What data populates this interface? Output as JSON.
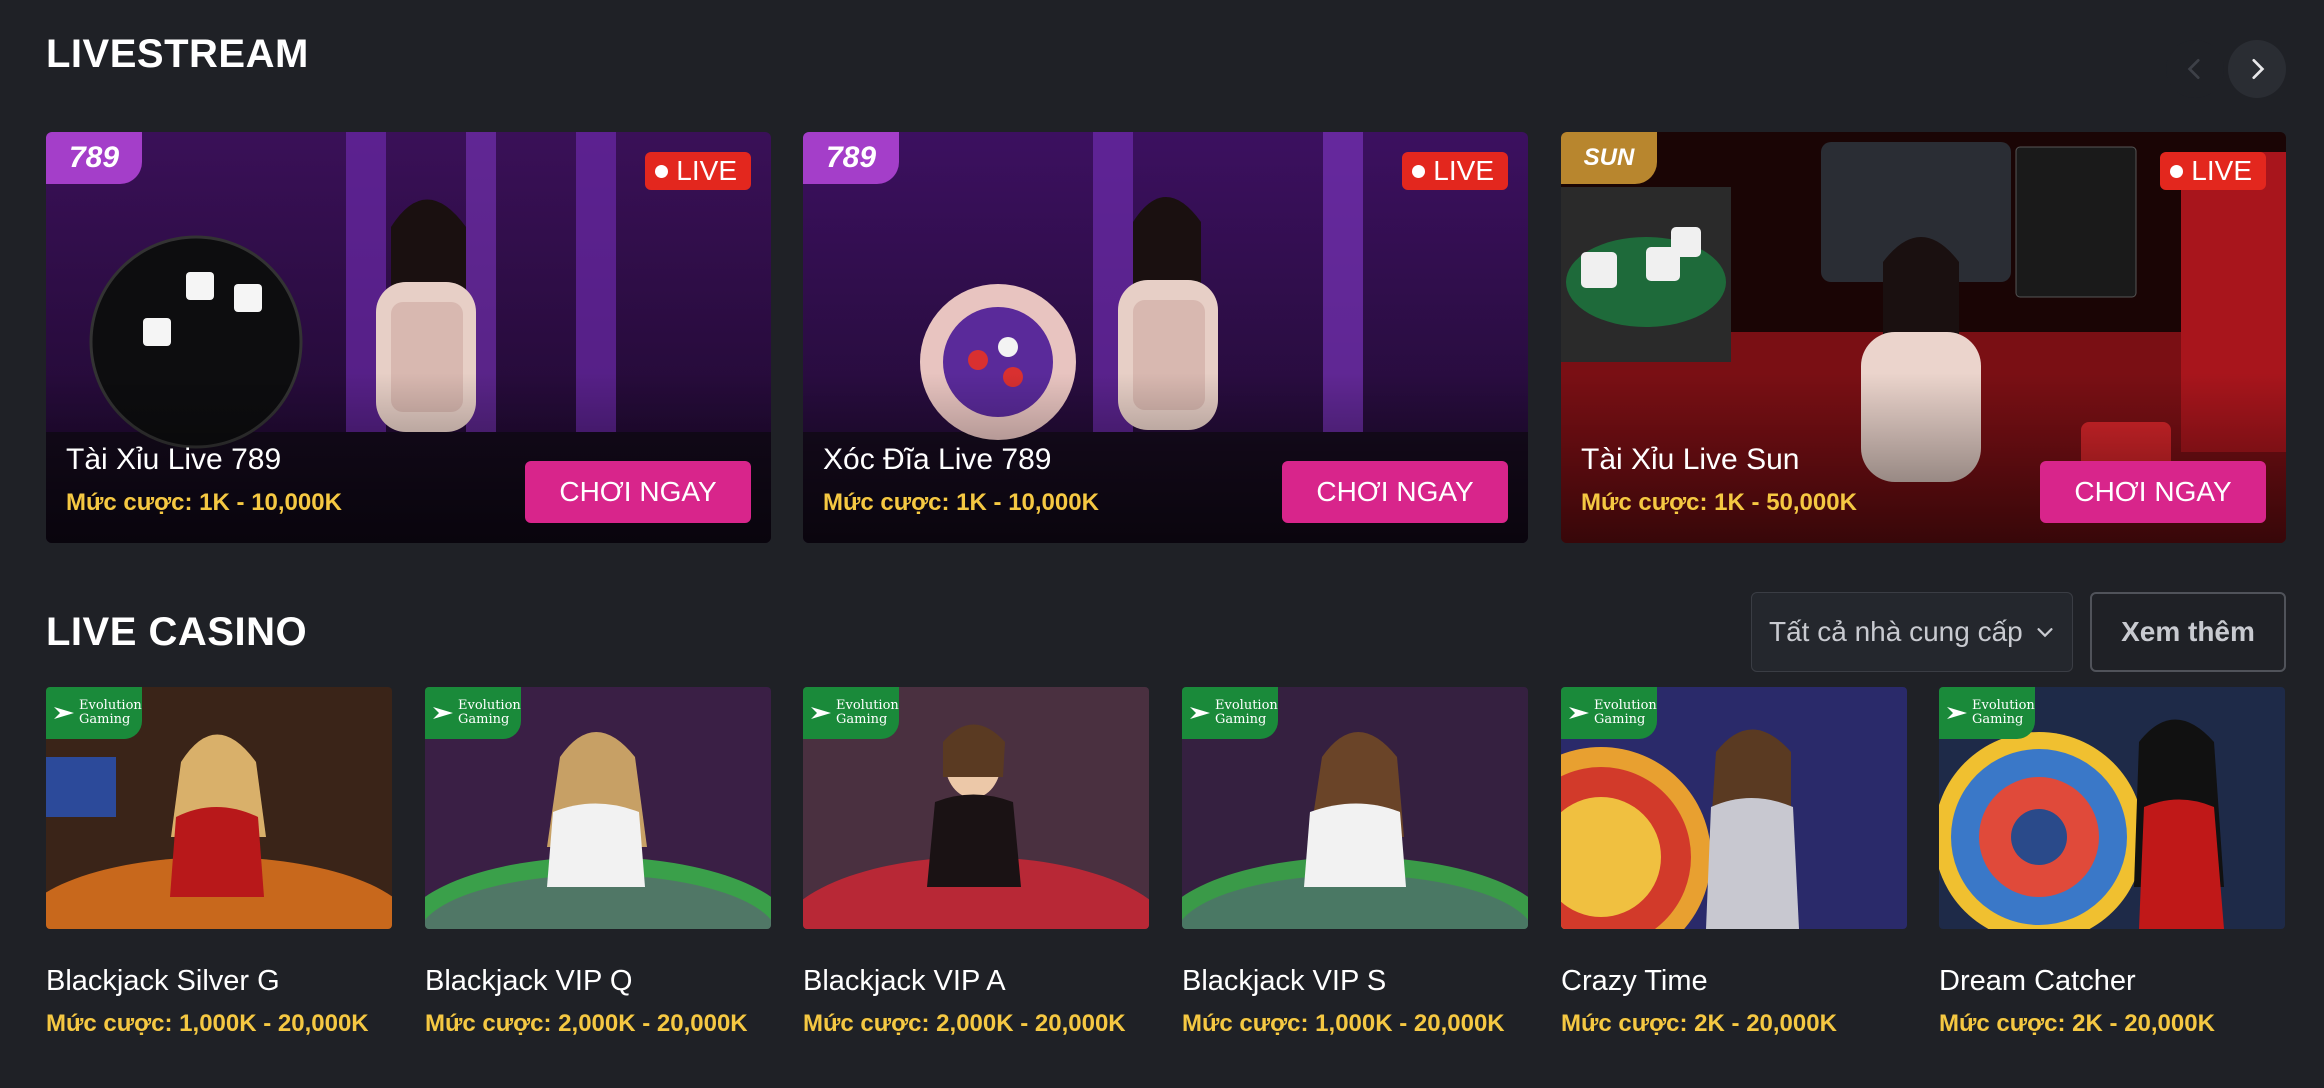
{
  "livestream": {
    "title": "LIVESTREAM",
    "cards": [
      {
        "brand": "789",
        "live_label": "LIVE",
        "name": "Tài Xỉu Live 789",
        "bet": "Mức cược: 1K - 10,000K",
        "play_label": "CHƠI NGAY"
      },
      {
        "brand": "789",
        "live_label": "LIVE",
        "name": "Xóc Đĩa Live 789",
        "bet": "Mức cược: 1K - 10,000K",
        "play_label": "CHƠI NGAY"
      },
      {
        "brand": "SUN",
        "live_label": "LIVE",
        "name": "Tài Xỉu Live Sun",
        "bet": "Mức cược: 1K - 50,000K",
        "play_label": "CHƠI NGAY"
      }
    ],
    "prev_icon": "chevron-left-icon",
    "next_icon": "chevron-right-icon"
  },
  "live_casino": {
    "title": "LIVE CASINO",
    "provider_select": "Tất cả nhà cung cấp",
    "more_label": "Xem thêm",
    "provider_logo": "Evolution Gaming",
    "provider_logo_lines": [
      "Evolution",
      "Gaming"
    ],
    "games": [
      {
        "name": "Blackjack Silver G",
        "bet": "Mức cược: 1,000K - 20,000K"
      },
      {
        "name": "Blackjack VIP Q",
        "bet": "Mức cược: 2,000K - 20,000K"
      },
      {
        "name": "Blackjack VIP A",
        "bet": "Mức cược: 2,000K - 20,000K"
      },
      {
        "name": "Blackjack VIP S",
        "bet": "Mức cược: 1,000K - 20,000K"
      },
      {
        "name": "Crazy Time",
        "bet": "Mức cược: 2K - 20,000K"
      },
      {
        "name": "Dream Catcher",
        "bet": "Mức cược: 2K - 20,000K"
      }
    ]
  },
  "colors": {
    "background": "#1f2126",
    "live_red": "#e3271e",
    "play_pink": "#d8258b",
    "bet_yellow": "#f5c842",
    "evolution_green": "#1a8a3a",
    "brand_789_purple": "#a43ec9"
  }
}
